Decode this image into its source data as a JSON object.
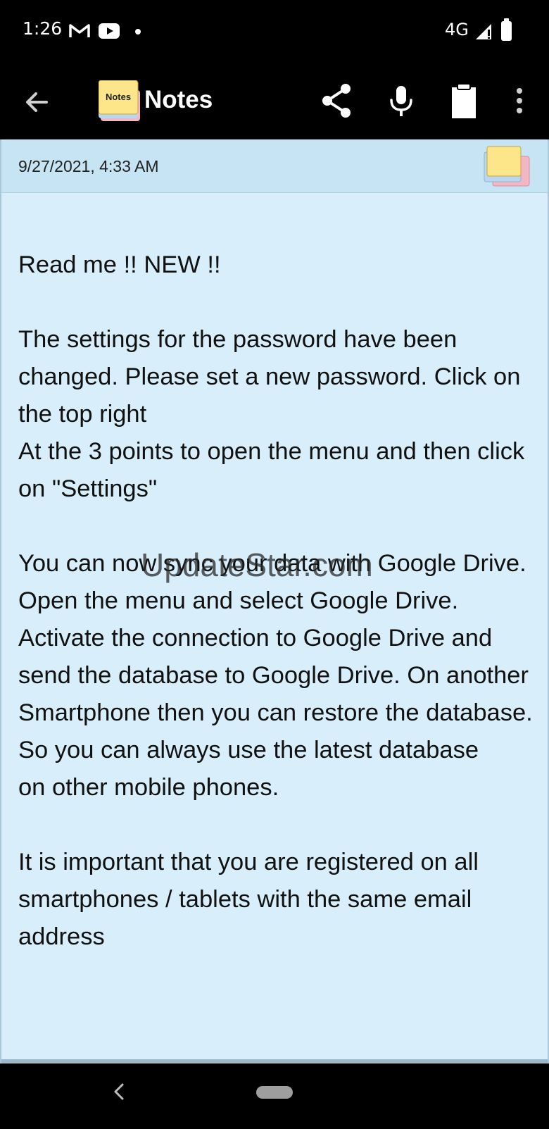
{
  "status_bar": {
    "time": "1:26",
    "network": "4G",
    "notifications": [
      "gmail-icon",
      "youtube-icon",
      "dot-icon"
    ]
  },
  "app_bar": {
    "logo_text": "Notes",
    "title": "Notes",
    "actions": [
      "back-arrow-icon",
      "share-icon",
      "mic-icon",
      "clipboard-icon",
      "more-vert-icon"
    ]
  },
  "note": {
    "date": "9/27/2021, 4:33 AM",
    "body": "Read me !! NEW !!\n\nThe settings for the password have been changed. Please set a new password. Click on the top right\nAt the 3 points to open the menu and then click on \"Settings\"\n\nYou can now sync your data with Google Drive. Open the menu and select Google Drive.\nActivate the connection to Google Drive and send the database to Google Drive. On another\nSmartphone then you can restore the database. So you can always use the latest database\non other mobile phones.\n\nIt is important that you are registered on all smartphones / tablets with the same email address",
    "colors": {
      "background": "#d8effb",
      "header": "#c6e4f4"
    }
  },
  "watermark": "UpdateStar.com"
}
